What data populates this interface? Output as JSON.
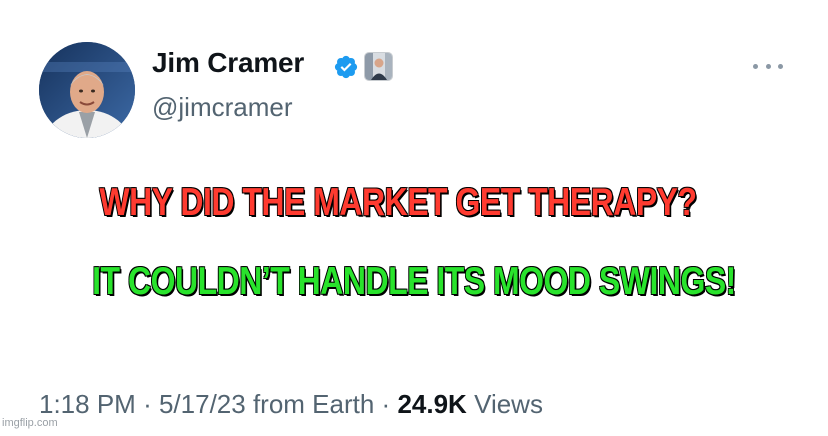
{
  "tweet": {
    "author": {
      "display_name": "Jim Cramer",
      "handle": "@jimcramer",
      "verified": true
    },
    "meme_lines": {
      "top": "WHY DID THE MARKET GET THERAPY?",
      "bottom": "IT COULDN’T HANDLE ITS MOOD SWINGS!"
    },
    "meta": {
      "time": "1:18 PM",
      "separator": "·",
      "date": "5/17/23 from Earth",
      "views_count": "24.9K",
      "views_label": "Views"
    }
  },
  "watermark": "imgflip.com",
  "colors": {
    "verified_blue": "#1d9bf0",
    "top_caption": "#ff3b30",
    "bottom_caption": "#29e32c",
    "secondary_text": "#536471"
  }
}
